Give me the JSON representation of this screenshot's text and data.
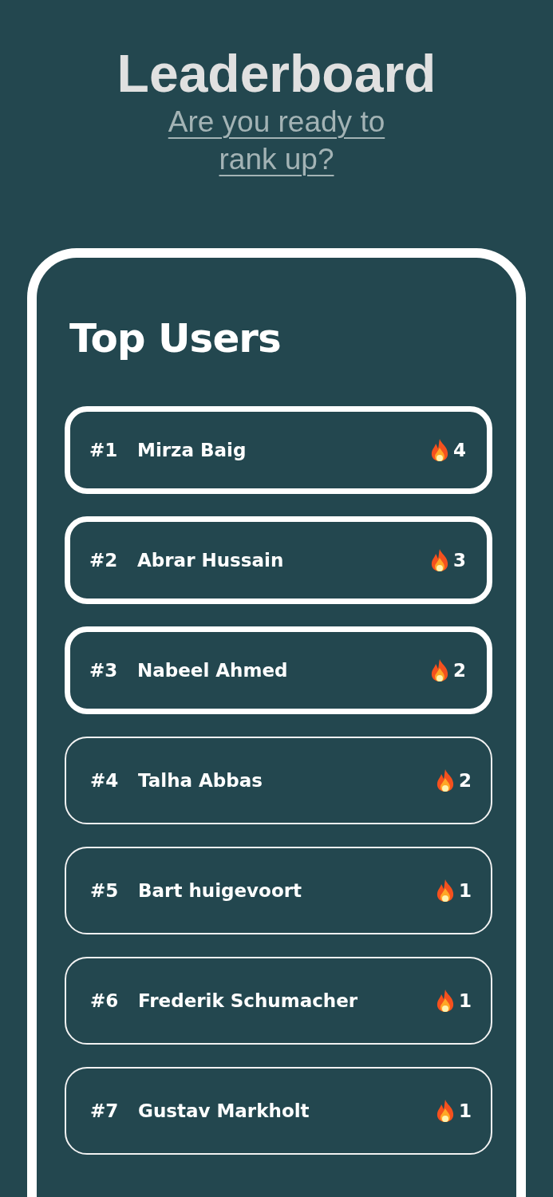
{
  "header": {
    "title": "Leaderboard",
    "subtitle": "Are you ready to rank up?"
  },
  "card": {
    "title": "Top Users",
    "rows": [
      {
        "rank": "#1",
        "name": "Mirza Baig",
        "score": "4",
        "highlighted": true
      },
      {
        "rank": "#2",
        "name": "Abrar Hussain",
        "score": "3",
        "highlighted": true
      },
      {
        "rank": "#3",
        "name": "Nabeel Ahmed",
        "score": "2",
        "highlighted": true
      },
      {
        "rank": "#4",
        "name": "Talha Abbas",
        "score": "2",
        "highlighted": false
      },
      {
        "rank": "#5",
        "name": "Bart huigevoort",
        "score": "1",
        "highlighted": false
      },
      {
        "rank": "#6",
        "name": "Frederik Schumacher",
        "score": "1",
        "highlighted": false
      },
      {
        "rank": "#7",
        "name": "Gustav Markholt",
        "score": "1",
        "highlighted": false
      }
    ]
  }
}
